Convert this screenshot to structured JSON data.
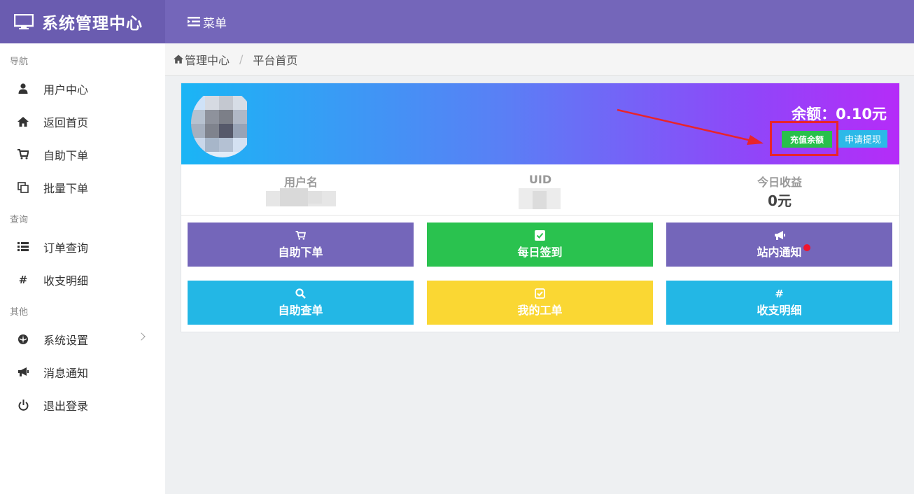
{
  "brand": {
    "title": "系统管理中心",
    "icon": "monitor-icon"
  },
  "topnav": {
    "menu_label": "菜单",
    "icon": "menu-icon"
  },
  "breadcrumb": {
    "home_label": "管理中心",
    "separator": "/",
    "current": "平台首页"
  },
  "sidebar": {
    "sections": [
      {
        "header": "导航",
        "items": [
          {
            "label": "用户中心",
            "icon": "user-icon"
          },
          {
            "label": "返回首页",
            "icon": "home-icon"
          },
          {
            "label": "自助下单",
            "icon": "cart-icon"
          },
          {
            "label": "批量下单",
            "icon": "copy-icon"
          }
        ]
      },
      {
        "header": "查询",
        "items": [
          {
            "label": "订单查询",
            "icon": "list-icon"
          },
          {
            "label": "收支明细",
            "icon": "hash-icon"
          }
        ]
      },
      {
        "header": "其他",
        "items": [
          {
            "label": "系统设置",
            "icon": "rebel-icon",
            "has_submenu": true
          },
          {
            "label": "消息通知",
            "icon": "bullhorn-icon"
          },
          {
            "label": "退出登录",
            "icon": "power-icon"
          }
        ]
      }
    ]
  },
  "profile": {
    "balance_text": "余额：0.10元",
    "recharge_label": "充值余额",
    "withdraw_label": "申请提现",
    "stats": [
      {
        "label": "用户名",
        "value": ""
      },
      {
        "label": "UID",
        "value": ""
      },
      {
        "label": "今日收益",
        "value": "0元"
      }
    ]
  },
  "tiles": [
    {
      "label": "自助下单",
      "icon": "cart-icon",
      "color": "#7466ba"
    },
    {
      "label": "每日签到",
      "icon": "checkbox-icon",
      "color": "#2ac24f"
    },
    {
      "label": "站内通知",
      "icon": "bullhorn-icon",
      "color": "#7466ba",
      "badge": true
    },
    {
      "label": "自助查单",
      "icon": "search-icon",
      "color": "#23b7e5"
    },
    {
      "label": "我的工单",
      "icon": "check-square-icon",
      "color": "#fad733"
    },
    {
      "label": "收支明细",
      "icon": "hash-icon",
      "color": "#23b7e5"
    }
  ],
  "colors": {
    "header": "#7466ba",
    "brand": "#6a5cb0",
    "highlight": "#e8242c"
  }
}
